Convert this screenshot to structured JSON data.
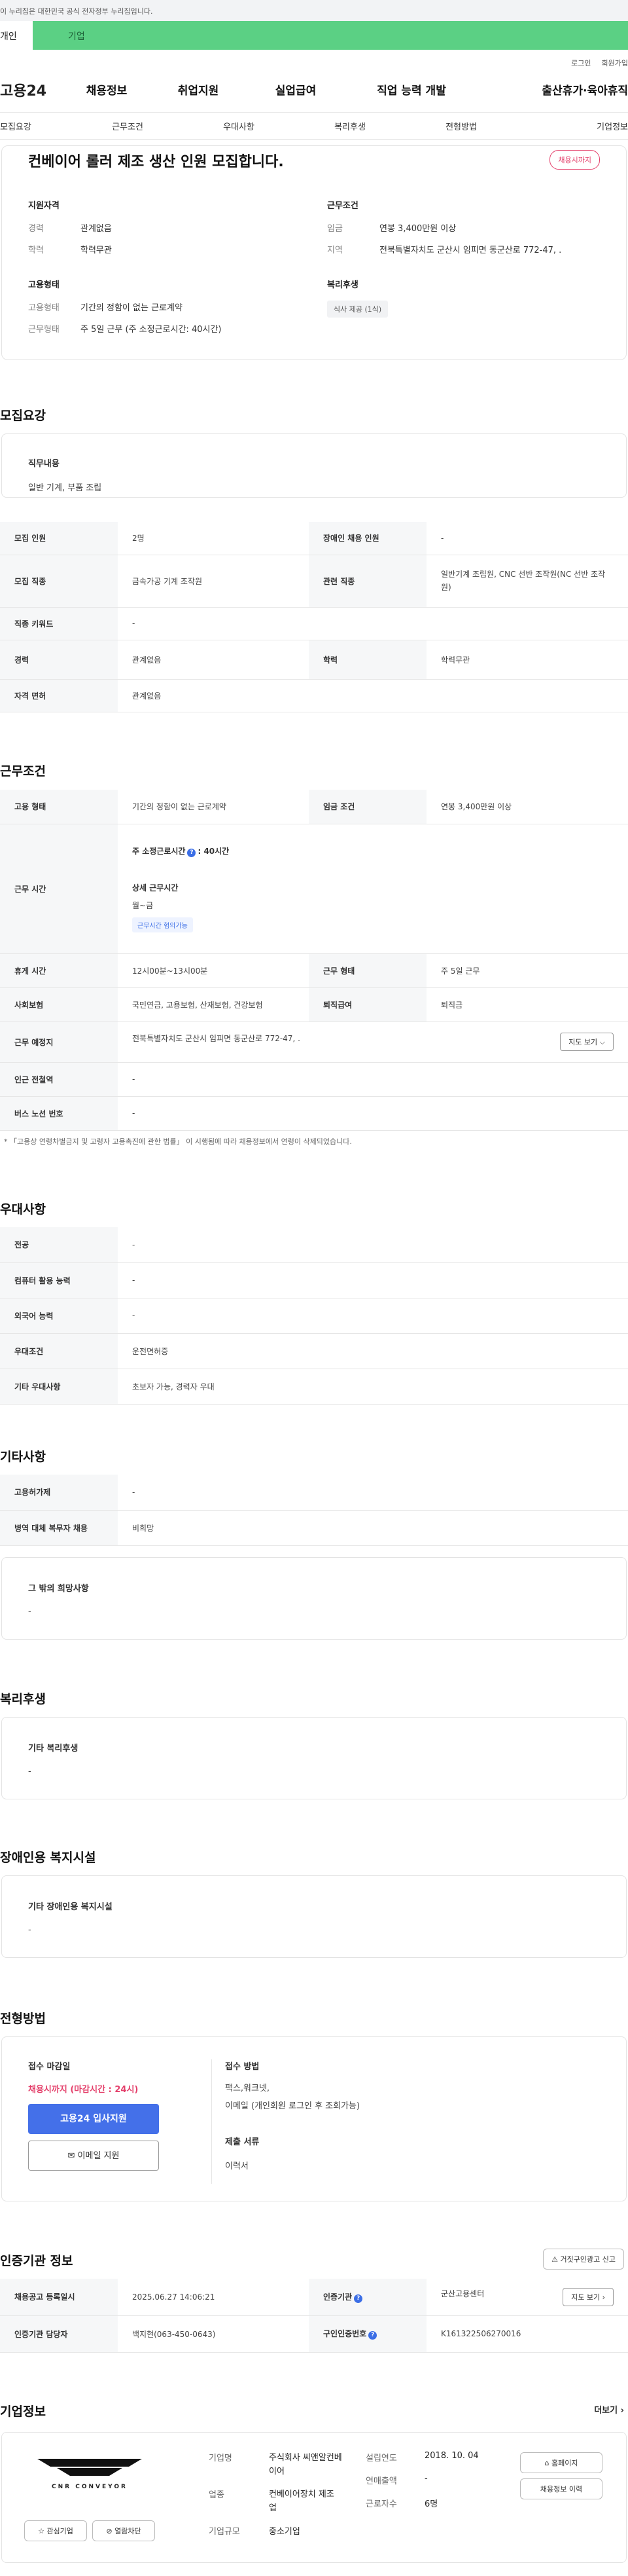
{
  "gov_notice": "이 누리집은 대한민국 공식 전자정부 누리집입니다.",
  "top_tabs": {
    "person": "개인",
    "company": "기업"
  },
  "util": {
    "login": "로그인",
    "signup": "회원가입"
  },
  "gnb": {
    "logo": "고용24",
    "items": [
      "채용정보",
      "취업지원",
      "실업급여",
      "직업 능력 개발",
      "출산휴가·육아휴직"
    ]
  },
  "subtabs": [
    "모집요강",
    "근무조건",
    "우대사항",
    "복리후생",
    "전형방법",
    "기업정보"
  ],
  "summary": {
    "title": "컨베이어 롤러 제조 생산 인원 모집합니다.",
    "badge": "채용시까지",
    "qual": {
      "title": "지원자격",
      "rows": [
        {
          "k": "경력",
          "v": "관계없음"
        },
        {
          "k": "학력",
          "v": "학력무관"
        }
      ]
    },
    "cond": {
      "title": "근무조건",
      "rows": [
        {
          "k": "임금",
          "v": "연봉 3,400만원 이상"
        },
        {
          "k": "지역",
          "v": "전북특별자치도 군산시 임피면 동군산로 772-47, ."
        }
      ]
    },
    "emp": {
      "title": "고용형태",
      "rows": [
        {
          "k": "고용형태",
          "v": "기간의 정함이 없는 근로계약"
        },
        {
          "k": "근무형태",
          "v": "주 5일 근무 (주 소정근로시간: 40시간)"
        }
      ]
    },
    "welfare": {
      "title": "복리후생",
      "tag": "식사 제공 (1식)"
    }
  },
  "recruit": {
    "heading": "모집요강",
    "duty_title": "직무내용",
    "duty_value": "일반 기계, 부품 조립",
    "rows": [
      [
        "모집 인원",
        "2명",
        "장애인 채용 인원",
        "-"
      ],
      [
        "모집 직종",
        "금속가공 기계 조작원",
        "관련 직종",
        "일반기계 조립원, CNC 선반 조작원(NC 선반 조작원)"
      ],
      [
        "직종 키워드",
        "-"
      ],
      [
        "경력",
        "관계없음",
        "학력",
        "학력무관"
      ],
      [
        "자격 면허",
        "관계없음"
      ]
    ]
  },
  "conditions": {
    "heading": "근무조건",
    "emp_k": "고용 형태",
    "emp_v": "기간의 정함이 없는 근로계약",
    "wage_k": "임금 조건",
    "wage_v": "연봉 3,400만원 이상",
    "hours_k": "근무 시간",
    "hours_main": "주 소정근로시간",
    "hours_main_v": ": 40시간",
    "detail_title": "상세 근무시간",
    "detail_days": "월~금",
    "detail_tag": "근무시간 협의가능",
    "rest_k": "휴게 시간",
    "rest_v": "12시00분~13시00분",
    "worktype_k": "근무 형태",
    "worktype_v": "주 5일 근무",
    "ins_k": "사회보험",
    "ins_v": "국민연금, 고용보험, 산재보험, 건강보험",
    "sev_k": "퇴직급여",
    "sev_v": "퇴직금",
    "place_k": "근무 예정지",
    "place_v": "전북특별자치도 군산시 임피면 동군산로 772-47, .",
    "map_btn": "지도 보기",
    "subway_k": "인근 전철역",
    "subway_v": "-",
    "bus_k": "버스 노선 번호",
    "bus_v": "-",
    "note": "* 「고용상 연령차별금지 및 고령자 고용촉진에 관한 법률」 이 시행됨에 따라 채용정보에서 연령이 삭제되었습니다."
  },
  "preference": {
    "heading": "우대사항",
    "rows": [
      [
        "전공",
        "-"
      ],
      [
        "컴퓨터 활용 능력",
        "-"
      ],
      [
        "외국어 능력",
        "-"
      ],
      [
        "우대조건",
        "운전면허증"
      ],
      [
        "기타 우대사항",
        "초보자 가능, 경력자 우대"
      ]
    ]
  },
  "etc": {
    "heading": "기타사항",
    "rows": [
      [
        "고용허가제",
        "-"
      ],
      [
        "병역 대체 복무자 채용",
        "비희망"
      ]
    ],
    "wish_title": "그 밖의 희망사항",
    "wish_value": "-"
  },
  "welfare": {
    "heading": "복리후생",
    "title": "기타 복리후생",
    "value": "-"
  },
  "disabled": {
    "heading": "장애인용 복지시설",
    "title": "기타 장애인용 복지시설",
    "value": "-"
  },
  "selection": {
    "heading": "전형방법",
    "deadline_title": "접수 마감일",
    "deadline_value": "채용시까지 (마감시간 : 24시)",
    "apply_btn": "고용24 입사지원",
    "email_btn": "이메일 지원",
    "method_title": "접수 방법",
    "method_value1": "팩스,워크넷,",
    "method_value2": "이메일 (개인회원 로그인 후 조회가능)",
    "doc_title": "제출 서류",
    "doc_value": "이력서"
  },
  "cert": {
    "heading": "인증기관 정보",
    "report_btn": "거짓구인광고 신고",
    "reg_k": "채용공고 등록일시",
    "reg_v": "2025.06.27 14:06:21",
    "org_k": "인증기관",
    "org_v": "군산고용센터",
    "map_btn": "지도 보기",
    "mgr_k": "인증기관 담당자",
    "mgr_v": "백지현(063-450-0643)",
    "no_k": "구인인증번호",
    "no_v": "K161322506270016"
  },
  "company": {
    "heading": "기업정보",
    "more": "더보기",
    "logo_text": "CNR CONVEYOR",
    "fav_btn": "관심기업",
    "block_btn": "열람차단",
    "name_k": "기업명",
    "name_v": "주식회사 씨앤알컨베이어",
    "biz_k": "업종",
    "biz_v": "컨베이어장치 제조업",
    "size_k": "기업규모",
    "size_v": "중소기업",
    "year_k": "설립연도",
    "year_v": "2018. 10. 04",
    "sales_k": "연매출액",
    "sales_v": "-",
    "emp_k": "근로자수",
    "emp_v": "6명",
    "home_btn": "홈페이지",
    "history_btn": "채용정보 이력"
  }
}
